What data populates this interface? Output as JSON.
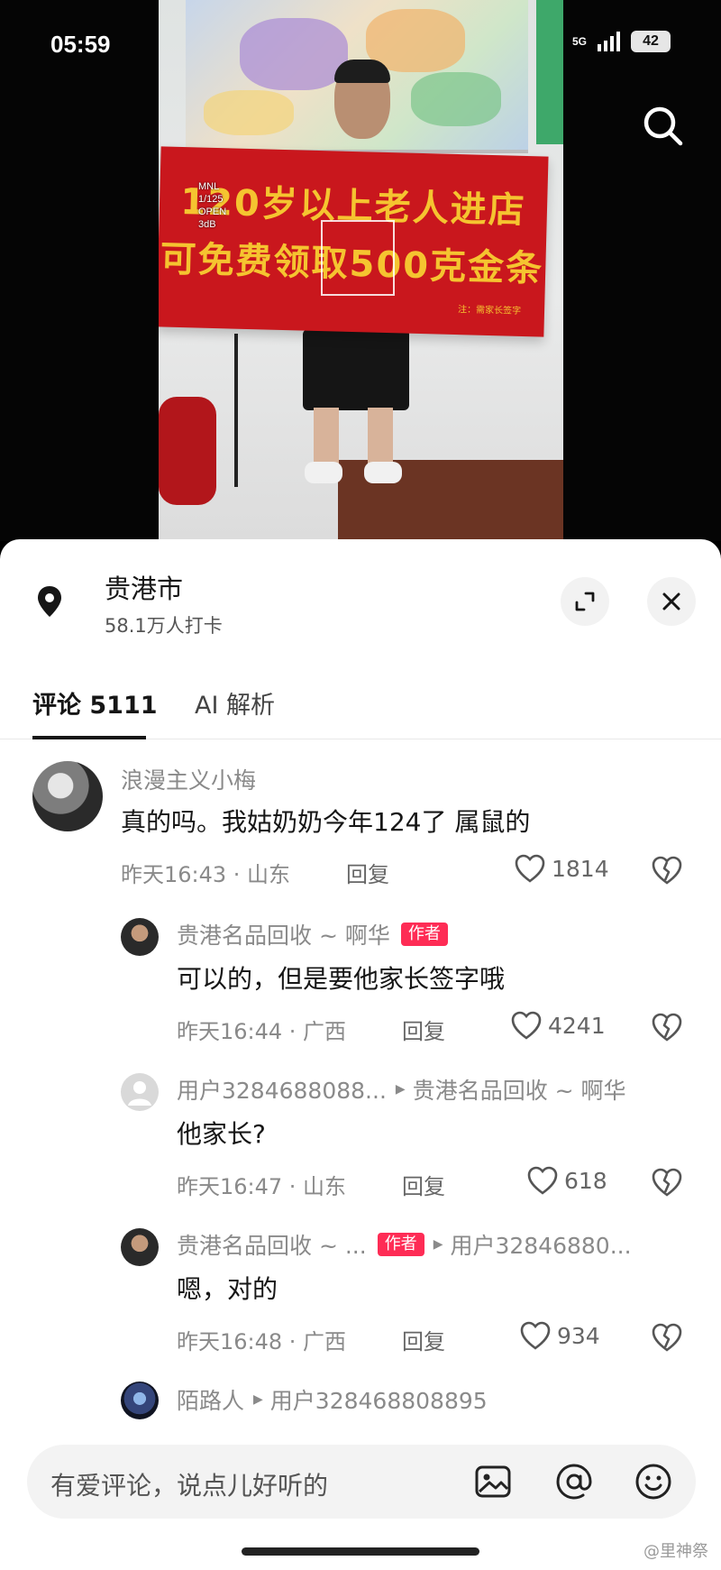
{
  "status_bar": {
    "time": "05:59",
    "network": "5G",
    "battery": "42"
  },
  "video": {
    "banner_line1": "120岁以上老人进店",
    "banner_line2": "可免费领取500克金条",
    "banner_note": "注：需家长签字",
    "camera_info": [
      "MNL",
      "1/125",
      "OPEN",
      "3dB"
    ]
  },
  "location": {
    "name": "贵港市",
    "checkins": "58.1万人打卡"
  },
  "tabs": {
    "comments": "评论 5111",
    "ai": "AI 解析"
  },
  "comments": [
    {
      "user": "浪漫主义小梅",
      "text": "真的吗。我姑奶奶今年124了 属鼠的",
      "time_region": "昨天16:43 · 山东",
      "reply": "回复",
      "likes": "1814"
    },
    {
      "user": "贵港名品回收 ~ 啊华",
      "tag": "作者",
      "text": "可以的，但是要他家长签字哦",
      "time_region": "昨天16:44 · 广西",
      "reply": "回复",
      "likes": "4241"
    },
    {
      "user": "用户3284688088...",
      "reply_to": "贵港名品回收 ~ 啊华",
      "text": "他家长?",
      "time_region": "昨天16:47 · 山东",
      "reply": "回复",
      "likes": "618"
    },
    {
      "user": "贵港名品回收 ~ ...",
      "tag": "作者",
      "reply_to": "用户32846880...",
      "text": "嗯，对的",
      "time_region": "昨天16:48 · 广西",
      "reply": "回复",
      "likes": "934"
    },
    {
      "user": "陌路人",
      "reply_to": "用户328468808895"
    }
  ],
  "input": {
    "placeholder": "有爱评论，说点儿好听的"
  },
  "watermark": "@里神祭",
  "colors": {
    "accent": "#fe2c55",
    "banner_red": "#c9171d",
    "banner_text": "#f5c430"
  },
  "icons": [
    "search-icon",
    "location-pin-icon",
    "expand-icon",
    "close-icon",
    "heart-icon",
    "dislike-heart-icon",
    "image-icon",
    "at-icon",
    "emoji-icon"
  ]
}
